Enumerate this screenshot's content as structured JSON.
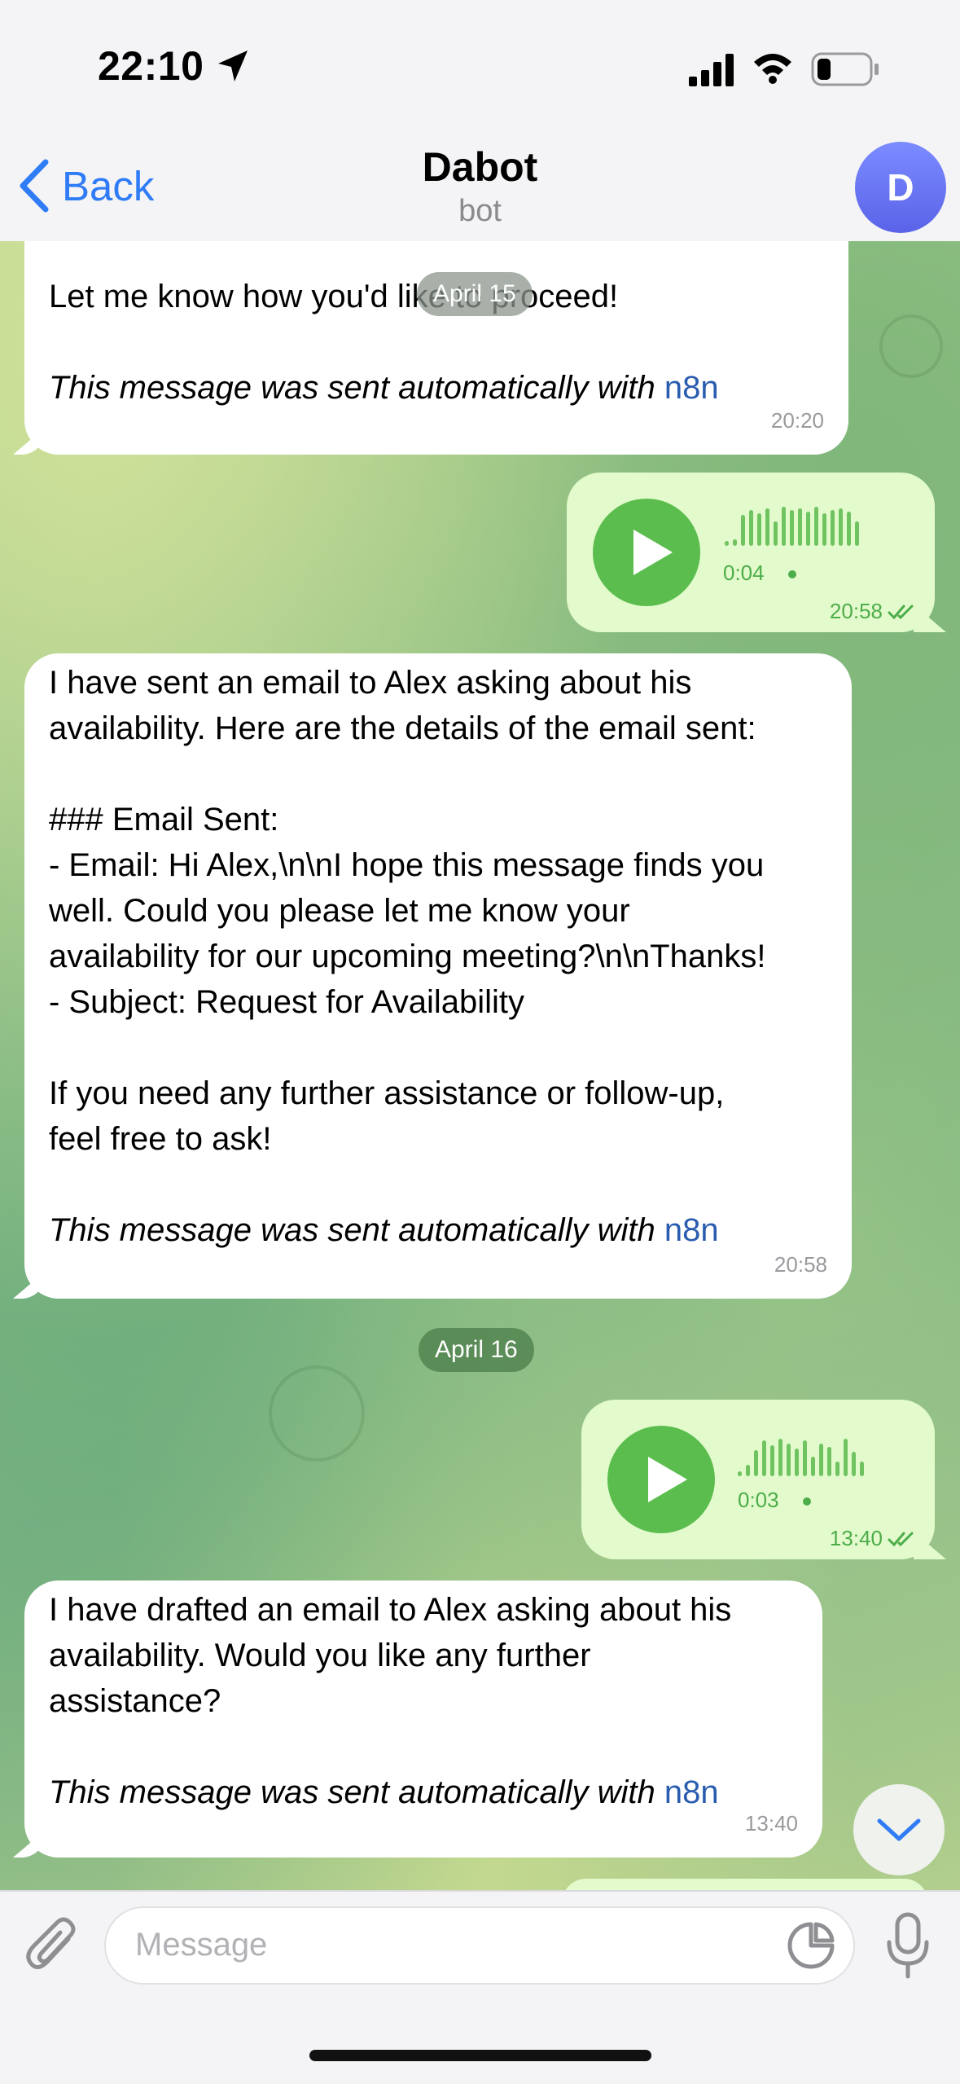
{
  "status_bar": {
    "time": "22:10"
  },
  "header": {
    "back_label": "Back",
    "title": "Dabot",
    "subtitle": "bot",
    "avatar_letter": "D"
  },
  "messages": {
    "m1": {
      "text": "Let me know how you'd like to proceed!",
      "footer_prefix": "This message was sent automatically with ",
      "footer_link": "n8n",
      "time": "20:20"
    },
    "v1": {
      "duration": "0:04",
      "time": "20:58"
    },
    "m2": {
      "text": "I have sent an email to Alex asking about his\navailability. Here are the details of the email sent:\n\n### Email Sent:\n- Email: Hi Alex,\\n\\nI hope this message finds you\nwell. Could you please let me know your\navailability for our upcoming meeting?\\n\\nThanks!\n- Subject: Request for Availability\n\nIf you need any further assistance or follow-up,\nfeel free to ask!",
      "footer_prefix": "This message was sent automatically with ",
      "footer_link": "n8n",
      "time": "20:58"
    },
    "v2": {
      "duration": "0:03",
      "time": "13:40"
    },
    "m3": {
      "text": "I have drafted an email to Alex asking about his\navailability. Would you like any further\nassistance?",
      "footer_prefix": "This message was sent automatically with ",
      "footer_link": "n8n",
      "time": "13:40"
    }
  },
  "date_separators": {
    "first": "April 15",
    "second": "April 16"
  },
  "composer": {
    "placeholder": "Message"
  },
  "icons": {
    "location": "location-arrow-icon",
    "signal": "signal-icon",
    "wifi": "wifi-icon",
    "battery": "battery-icon",
    "back": "chevron-left-icon",
    "attach": "paperclip-icon",
    "sticker": "sticker-icon",
    "mic": "microphone-icon",
    "read": "double-check-icon",
    "scroll": "chevron-down-icon"
  },
  "colors": {
    "accent": "#2f7cf6",
    "outgoing_bubble": "#e3fbcc",
    "play": "#5cbd4f",
    "avatar": "#6b74f0"
  }
}
